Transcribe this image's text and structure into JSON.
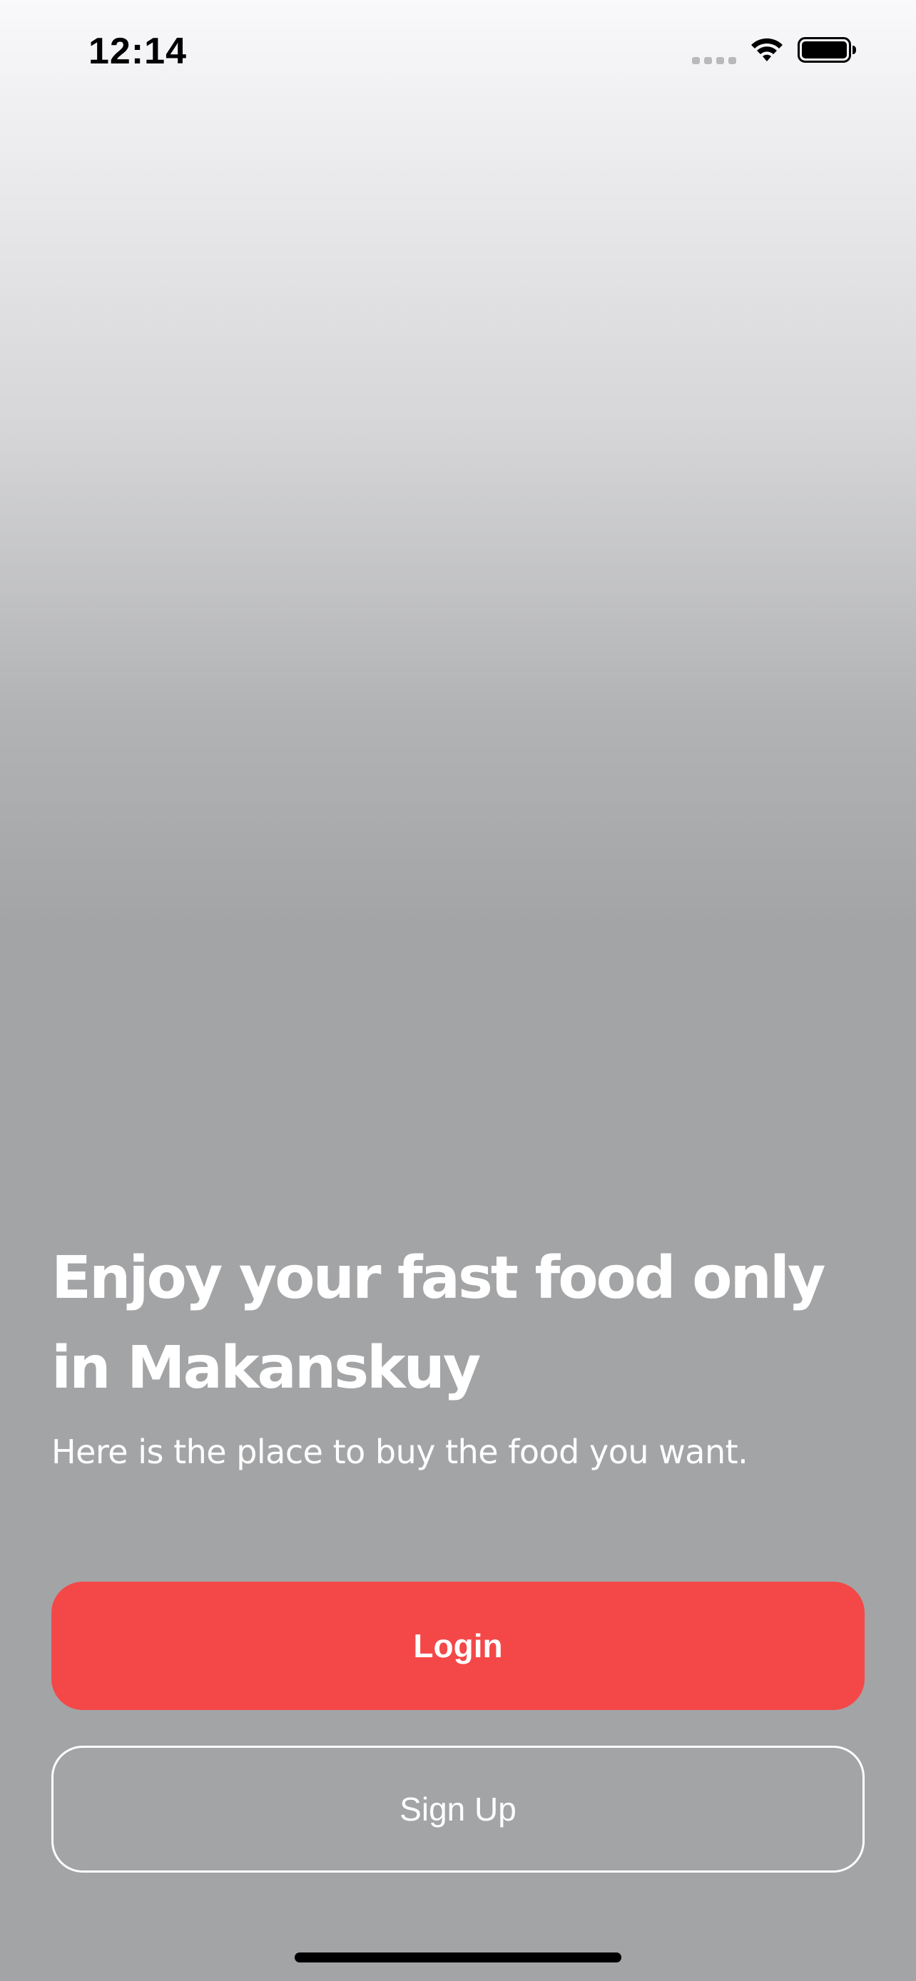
{
  "status_bar": {
    "time": "12:14",
    "icons": [
      "signal-icon",
      "wifi-icon",
      "battery-icon"
    ]
  },
  "main": {
    "headline": "Enjoy your fast food only in Makanskuy",
    "subtitle": "Here is the place to buy the food you want."
  },
  "buttons": {
    "login_label": "Login",
    "signup_label": "Sign Up"
  },
  "colors": {
    "accent": "#f44848",
    "text_on_dark": "#ffffff",
    "background_bottom": "#a3a4a6"
  }
}
